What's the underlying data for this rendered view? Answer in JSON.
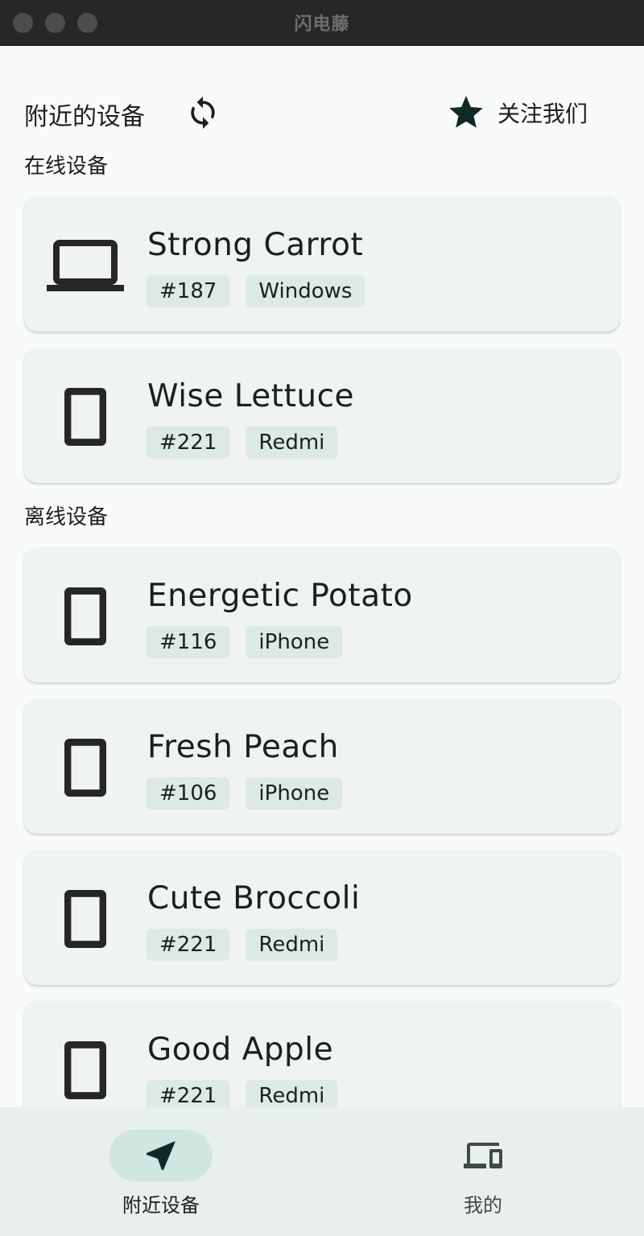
{
  "window": {
    "title": "闪电藤"
  },
  "header": {
    "title": "附近的设备",
    "refresh_icon": "refresh-icon",
    "follow_label": "关注我们",
    "follow_icon": "star-icon"
  },
  "sections": {
    "online_label": "在线设备",
    "offline_label": "离线设备"
  },
  "online_devices": [
    {
      "name": "Strong Carrot",
      "id": "#187",
      "platform": "Windows",
      "icon": "laptop-icon"
    },
    {
      "name": "Wise Lettuce",
      "id": "#221",
      "platform": "Redmi",
      "icon": "tablet-icon"
    }
  ],
  "offline_devices": [
    {
      "name": "Energetic Potato",
      "id": "#116",
      "platform": "iPhone",
      "icon": "tablet-icon"
    },
    {
      "name": "Fresh Peach",
      "id": "#106",
      "platform": "iPhone",
      "icon": "tablet-icon"
    },
    {
      "name": "Cute Broccoli",
      "id": "#221",
      "platform": "Redmi",
      "icon": "tablet-icon"
    },
    {
      "name": "Good Apple",
      "id": "#221",
      "platform": "Redmi",
      "icon": "tablet-icon"
    }
  ],
  "bottom_nav": [
    {
      "label": "附近设备",
      "icon": "send-icon",
      "selected": true
    },
    {
      "label": "我的",
      "icon": "devices-icon",
      "selected": false
    }
  ],
  "colors": {
    "background": "#f9fbfa",
    "card": "#eff3f1",
    "tag": "#dde9e6",
    "nav_bg": "#e8efec",
    "nav_pill": "#cfe6e1",
    "accent_dark": "#0f2a24"
  }
}
